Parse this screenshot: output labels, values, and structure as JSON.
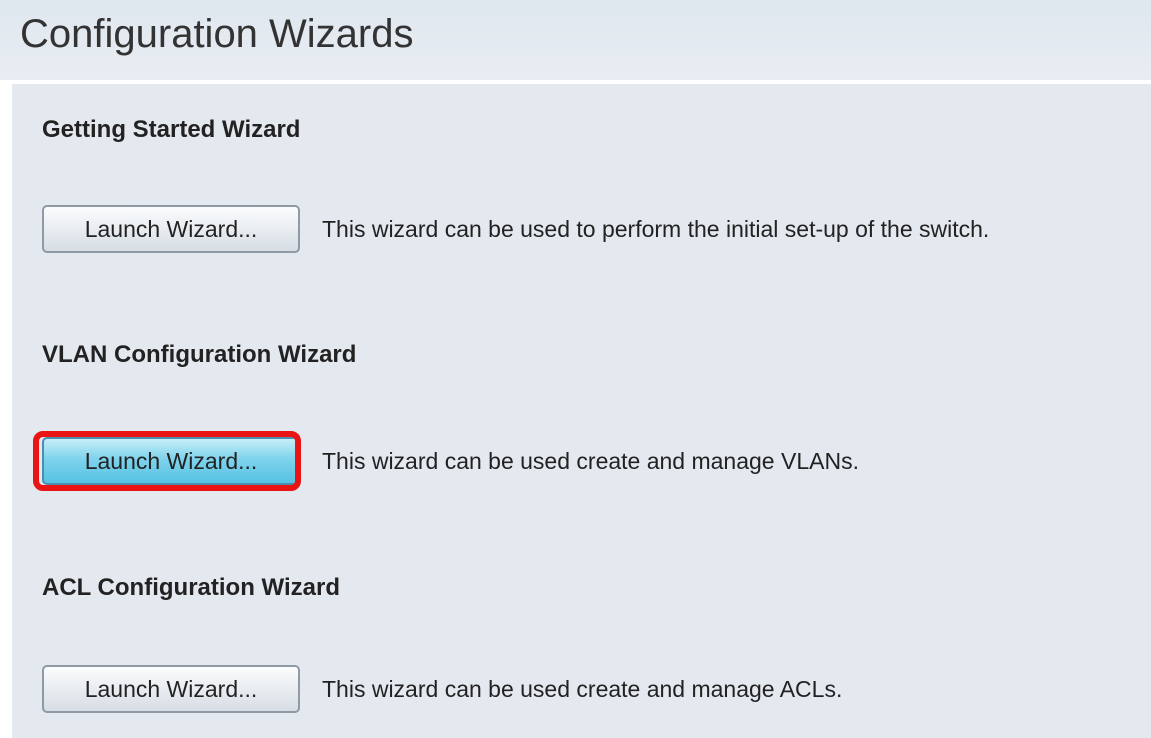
{
  "page": {
    "title": "Configuration Wizards"
  },
  "wizards": [
    {
      "heading": "Getting Started Wizard",
      "button_label": "Launch Wizard...",
      "description": "This wizard can be used to perform the initial set-up of the switch."
    },
    {
      "heading": "VLAN Configuration Wizard",
      "button_label": "Launch Wizard...",
      "description": "This wizard can be used create and manage VLANs.",
      "highlighted": true
    },
    {
      "heading": "ACL Configuration Wizard",
      "button_label": "Launch Wizard...",
      "description": "This wizard can be used create and manage ACLs."
    }
  ],
  "colors": {
    "highlight_ring": "#ea1414",
    "highlighted_button": "#56c2e4",
    "panel_background": "#e4e9ef"
  }
}
